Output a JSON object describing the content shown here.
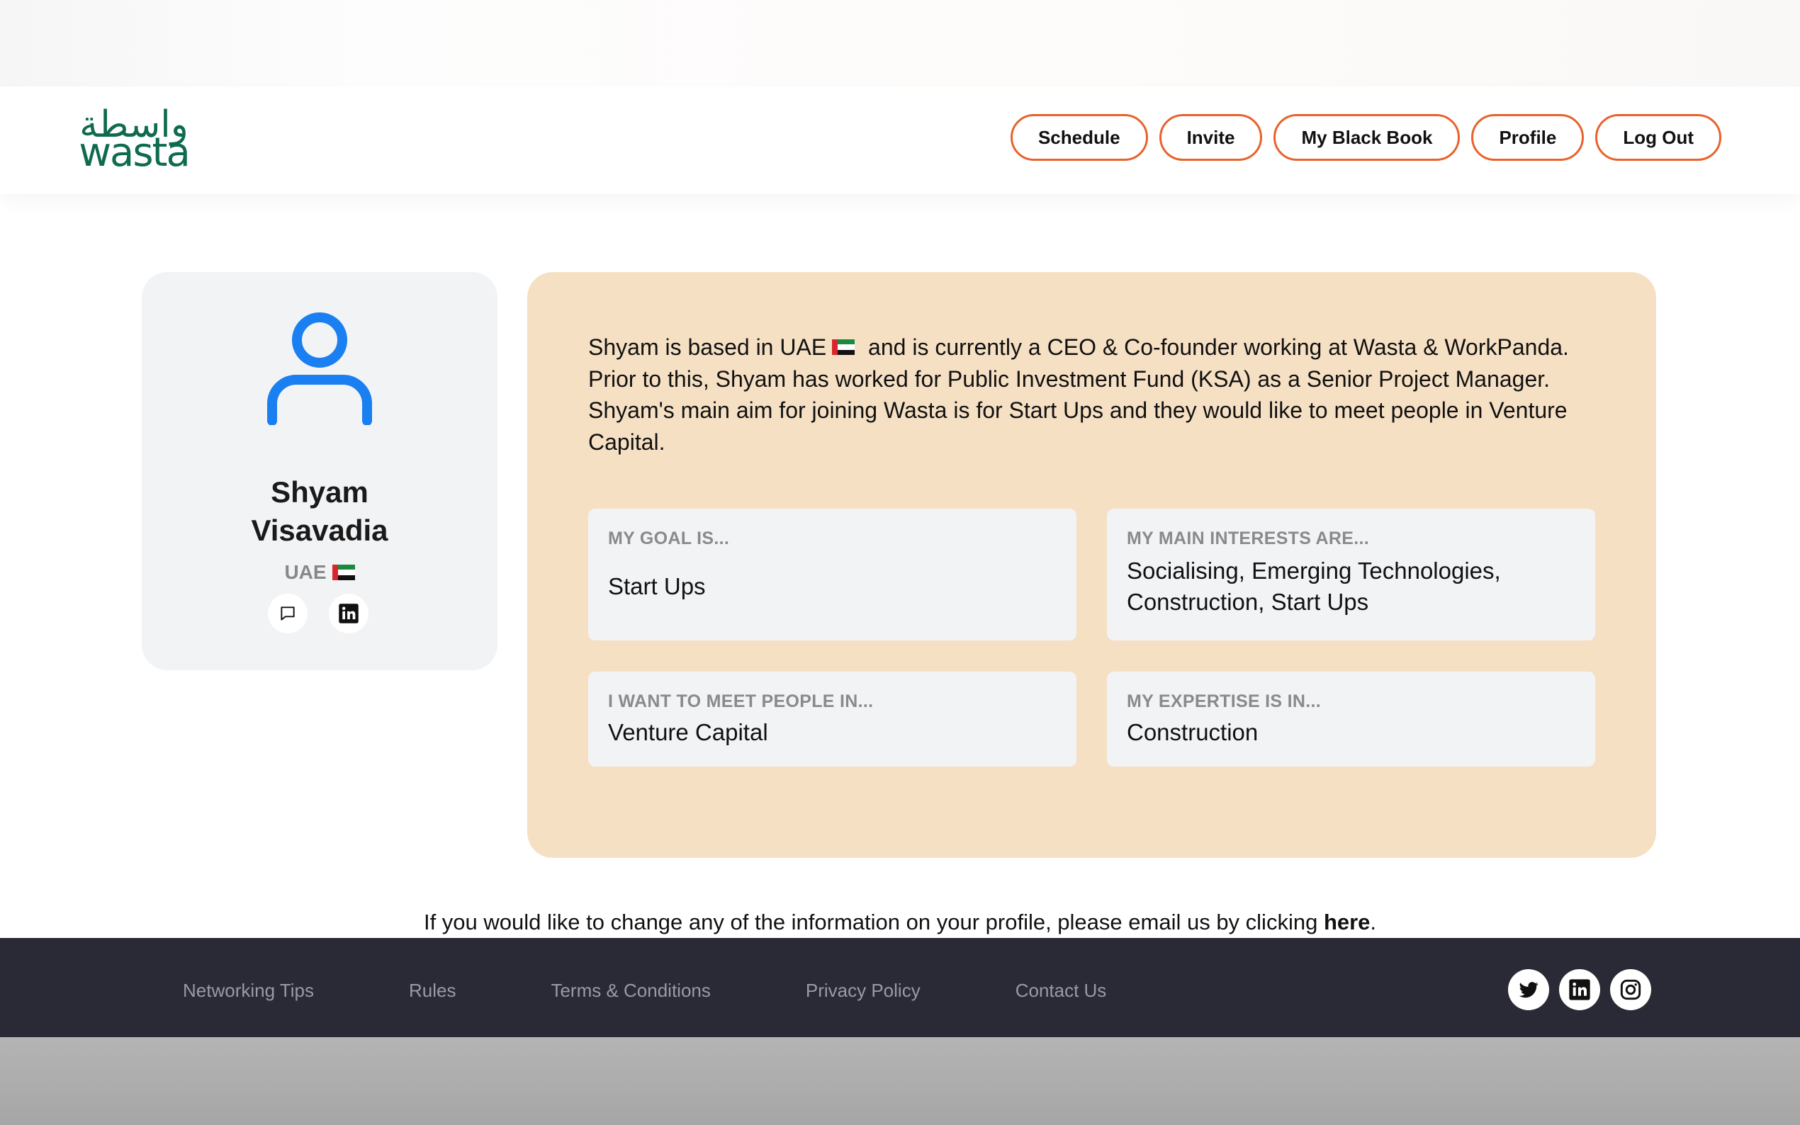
{
  "brand": {
    "logo_arabic": "واسطة",
    "logo_text": "wasta"
  },
  "nav": {
    "items": [
      {
        "label": "Schedule"
      },
      {
        "label": "Invite"
      },
      {
        "label": "My Black Book"
      },
      {
        "label": "Profile"
      },
      {
        "label": "Log Out"
      }
    ]
  },
  "profile": {
    "first_name": "Shyam",
    "last_name": "Visavadia",
    "country": "UAE",
    "avatar_icon": "user-icon",
    "actions": [
      {
        "icon": "message-icon"
      },
      {
        "icon": "linkedin-icon"
      }
    ]
  },
  "bio": {
    "part1": "Shyam is based in UAE",
    "part2": "and is currently a CEO & Co-founder working at Wasta & WorkPanda. Prior to this, Shyam has worked for Public Investment Fund (KSA) as a Senior Project Manager. Shyam's main aim for joining Wasta is for Start Ups and they would like to meet people in Venture Capital."
  },
  "info": {
    "goal": {
      "label": "MY GOAL IS...",
      "value": "Start Ups"
    },
    "interests": {
      "label": "MY MAIN INTERESTS ARE...",
      "value": "Socialising, Emerging Technologies, Construction, Start Ups"
    },
    "meet": {
      "label": "I WANT TO MEET PEOPLE IN...",
      "value": "Venture Capital"
    },
    "expertise": {
      "label": "MY EXPERTISE IS IN...",
      "value": "Construction"
    }
  },
  "change_note": {
    "text": "If you would like to change any of the information on your profile, please email us by clicking",
    "link": "here",
    "end": "."
  },
  "footer": {
    "links": [
      {
        "label": "Networking Tips"
      },
      {
        "label": "Rules"
      },
      {
        "label": "Terms & Conditions"
      },
      {
        "label": "Privacy Policy"
      },
      {
        "label": "Contact Us"
      }
    ],
    "social": [
      {
        "icon": "twitter-icon"
      },
      {
        "icon": "linkedin-icon"
      },
      {
        "icon": "instagram-icon"
      }
    ]
  },
  "colors": {
    "accent": "#e8622c",
    "brand_green": "#0f6b4f",
    "avatar_blue": "#1a7ff0",
    "bio_background": "#f6e0c4",
    "footer_background": "#2a2a36"
  }
}
